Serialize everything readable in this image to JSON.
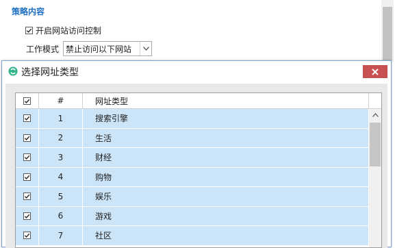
{
  "settings": {
    "section_title": "策略内容",
    "enable_label": "开启网站访问控制",
    "enable_checked": true,
    "mode_label": "工作模式",
    "mode_value": "禁止访问以下网站"
  },
  "dialog": {
    "title": "选择网址类型",
    "close_icon": "close-icon",
    "columns": {
      "check": "",
      "number": "#",
      "type": "网址类型"
    },
    "header_checked": true,
    "rows": [
      {
        "num": "1",
        "type": "搜索引擎",
        "checked": true
      },
      {
        "num": "2",
        "type": "生活",
        "checked": true
      },
      {
        "num": "3",
        "type": "财经",
        "checked": true
      },
      {
        "num": "4",
        "type": "购物",
        "checked": true
      },
      {
        "num": "5",
        "type": "娱乐",
        "checked": true
      },
      {
        "num": "6",
        "type": "游戏",
        "checked": true
      },
      {
        "num": "7",
        "type": "社区",
        "checked": true
      }
    ]
  },
  "colors": {
    "accent": "#1e6fc4",
    "row_selected": "#cce4f7",
    "close_button": "#c75050"
  }
}
